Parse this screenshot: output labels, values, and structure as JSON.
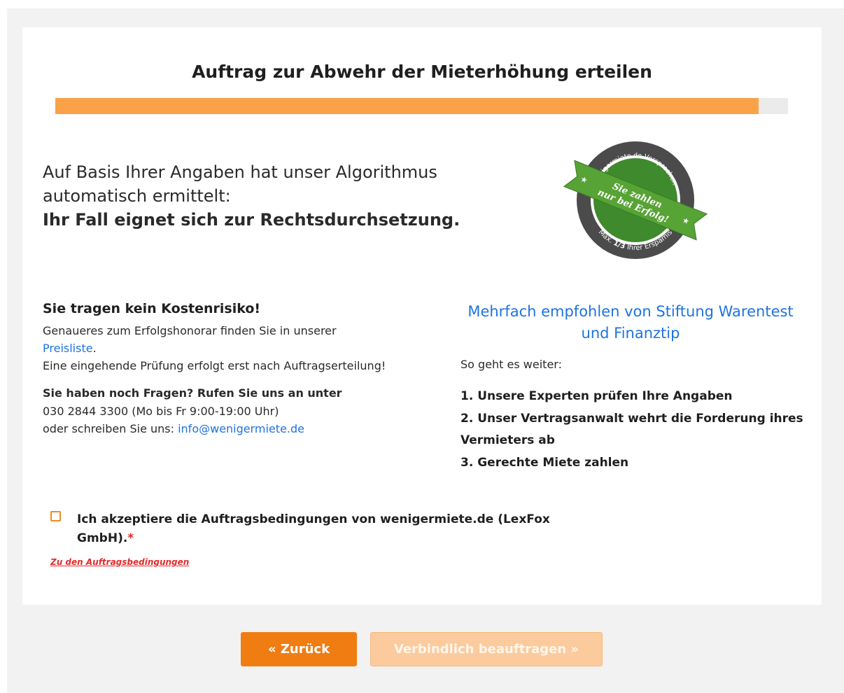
{
  "header": {
    "title": "Auftrag zur Abwehr der Mieterhöhung erteilen",
    "progress_fraction": 0.96
  },
  "intro": {
    "line1": "Auf Basis Ihrer Angaben hat unser Algorithmus automatisch ermittelt:",
    "line2": "Ihr Fall eignet sich zur Rechtsdurchsetzung."
  },
  "badge": {
    "ring_top": "wenigermiete.de Versprechen",
    "ring_bottom_prefix": "Max.",
    "ring_bottom_fraction": "1/3",
    "ring_bottom_suffix": "Ihrer Ersparnis",
    "ribbon_line1": "Sie zahlen",
    "ribbon_line2": "nur bei Erfolg!",
    "colors": {
      "ring": "#4b4b4b",
      "green": "#3f8a2c",
      "ribbon": "#57a336"
    }
  },
  "cost": {
    "heading": "Sie tragen kein Kostenrisiko!",
    "text1": "Genaueres zum Erfolgshonorar finden Sie in unserer",
    "link": "Preisliste",
    "text2": ".",
    "text3": "Eine eingehende Prüfung erfolgt erst nach Auftragserteilung!",
    "question": "Sie haben noch Fragen? Rufen Sie uns an unter",
    "phone": "030 2844 3300 (Mo bis Fr 9:00-19:00 Uhr)",
    "write_prefix": "oder schreiben Sie uns: ",
    "email": "info@wenigermiete.de"
  },
  "recommend": {
    "title": "Mehrfach empfohlen von Stiftung Warentest und Finanztip",
    "next": "So geht es weiter:",
    "steps": [
      "1. Unsere Experten prüfen Ihre Angaben",
      "2. Unser Vertragsanwalt wehrt die Forderung ihres Vermieters ab",
      "3. Gerechte Miete zahlen"
    ]
  },
  "agreement": {
    "label": "Ich akzeptiere die Auftragsbedingungen von wenigermiete.de (LexFox GmbH).",
    "required_mark": "*",
    "link": "Zu den Auftragsbedingungen",
    "checked": false
  },
  "buttons": {
    "back": "« Zurück",
    "submit": "Verbindlich beauftragen »"
  },
  "colors": {
    "accent": "#f07d12",
    "progress": "#f9a24a",
    "link": "#1e73e0",
    "required": "#e02b2b"
  }
}
